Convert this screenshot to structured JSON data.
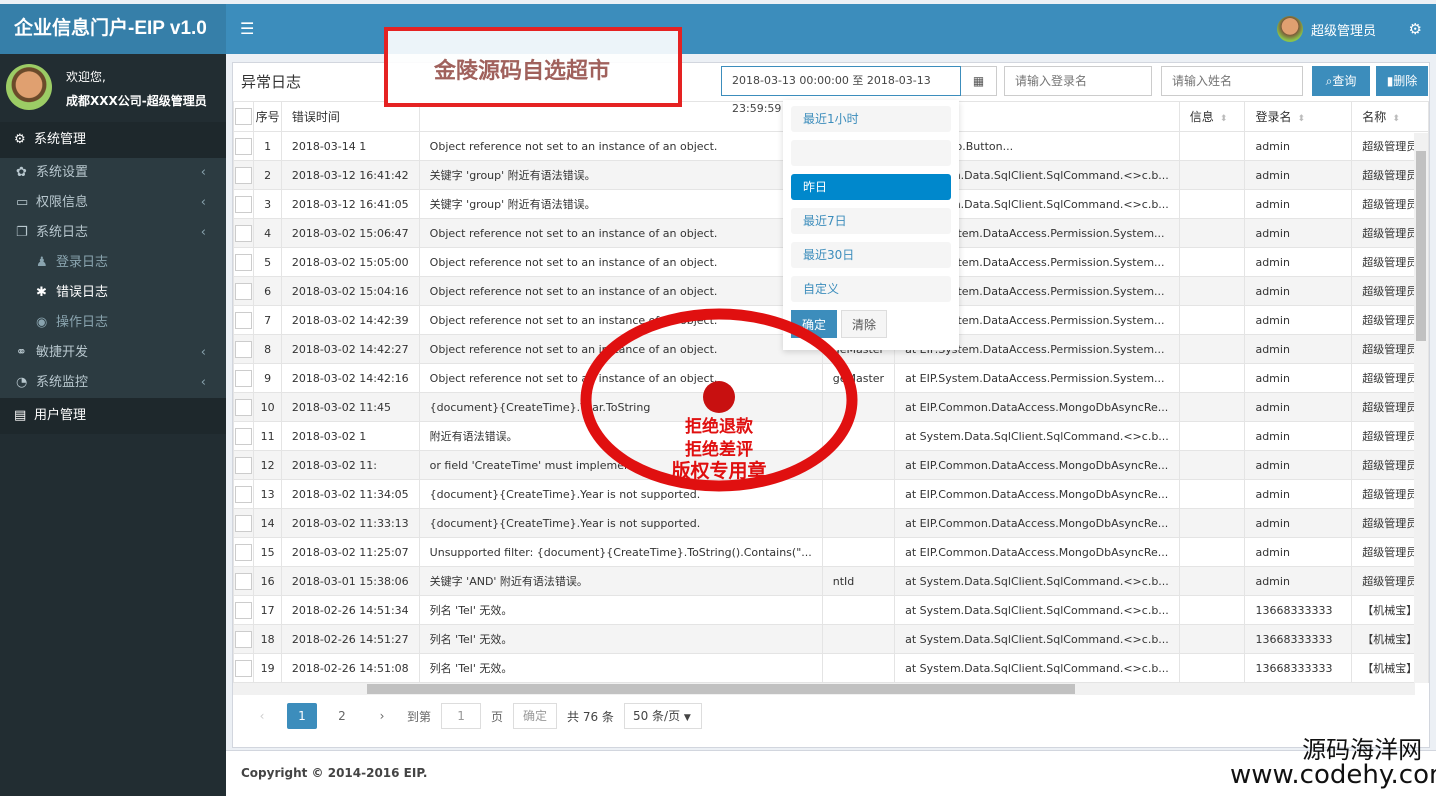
{
  "app": {
    "title": "企业信息门户-EIP v1.0"
  },
  "topbar": {
    "username": "超级管理员"
  },
  "user_panel": {
    "welcome": "欢迎您,",
    "company": "成都XXX公司-超级管理员"
  },
  "sidebar": {
    "sys_mgmt": "系统管理",
    "items": [
      {
        "label": "系统设置",
        "icon": "gear-icon"
      },
      {
        "label": "权限信息",
        "icon": "monitor-icon"
      },
      {
        "label": "系统日志",
        "icon": "files-icon"
      }
    ],
    "log_items": [
      {
        "label": "登录日志",
        "icon": "user-icon"
      },
      {
        "label": "错误日志",
        "icon": "bug-icon",
        "active": true
      },
      {
        "label": "操作日志",
        "icon": "eye-icon"
      }
    ],
    "items2": [
      {
        "label": "敏捷开发",
        "icon": "handshake-icon"
      },
      {
        "label": "系统监控",
        "icon": "dashboard-icon"
      }
    ],
    "user_mgmt": "用户管理"
  },
  "page": {
    "title": "异常日志",
    "date_range": "2018-03-13 00:00:00 至 2018-03-13 23:59:59",
    "login_placeholder": "请输入登录名",
    "name_placeholder": "请输入姓名",
    "search_label": "查询",
    "delete_label": "删除"
  },
  "date_dropdown": {
    "options": [
      "最近1小时",
      "",
      "昨日",
      "最近7日",
      "最近30日",
      "自定义"
    ],
    "active": "昨日",
    "ok": "确定",
    "clear": "清除"
  },
  "table": {
    "headers": [
      "序号",
      "错误时间",
      "",
      "",
      "",
      "信息",
      "登录名",
      "名称"
    ],
    "rows": [
      [
        "1",
        "2018-03-14 1",
        "Object reference not set to an instance of an object.",
        "",
        "at EIP.Web.Button...",
        "",
        "admin",
        "超级管理员"
      ],
      [
        "2",
        "2018-03-12 16:41:42",
        "关键字 'group' 附近有语法错误。",
        "",
        "at System.Data.SqlClient.SqlCommand.<>c.b...",
        "",
        "admin",
        "超级管理员"
      ],
      [
        "3",
        "2018-03-12 16:41:05",
        "关键字 'group' 附近有语法错误。",
        "",
        "at System.Data.SqlClient.SqlCommand.<>c.b...",
        "",
        "admin",
        "超级管理员"
      ],
      [
        "4",
        "2018-03-02 15:06:47",
        "Object reference not set to an instance of an object.",
        "",
        "at EIP.System.DataAccess.Permission.System...",
        "",
        "admin",
        "超级管理员"
      ],
      [
        "5",
        "2018-03-02 15:05:00",
        "Object reference not set to an instance of an object.",
        "",
        "at EIP.System.DataAccess.Permission.System...",
        "",
        "admin",
        "超级管理员"
      ],
      [
        "6",
        "2018-03-02 15:04:16",
        "Object reference not set to an instance of an object.",
        "",
        "at EIP.System.DataAccess.Permission.System...",
        "",
        "admin",
        "超级管理员"
      ],
      [
        "7",
        "2018-03-02 14:42:39",
        "Object reference not set to an instance of an object.",
        "",
        "at EIP.System.DataAccess.Permission.System...",
        "",
        "admin",
        "超级管理员"
      ],
      [
        "8",
        "2018-03-02 14:42:27",
        "Object reference not set to an instance of an object.",
        "geMaster",
        "at EIP.System.DataAccess.Permission.System...",
        "",
        "admin",
        "超级管理员"
      ],
      [
        "9",
        "2018-03-02 14:42:16",
        "Object reference not set to an instance of an object.",
        "geMaster",
        "at EIP.System.DataAccess.Permission.System...",
        "",
        "admin",
        "超级管理员"
      ],
      [
        "10",
        "2018-03-02 11:45",
        "{document}{CreateTime}.Year.ToString",
        "",
        "at EIP.Common.DataAccess.MongoDbAsyncRe...",
        "",
        "admin",
        "超级管理员"
      ],
      [
        "11",
        "2018-03-02 1",
        "附近有语法错误。",
        "",
        "at System.Data.SqlClient.SqlCommand.<>c.b...",
        "",
        "admin",
        "超级管理员"
      ],
      [
        "12",
        "2018-03-02 11:",
        "or field 'CreateTime' must implement",
        "",
        "at EIP.Common.DataAccess.MongoDbAsyncRe...",
        "",
        "admin",
        "超级管理员"
      ],
      [
        "13",
        "2018-03-02 11:34:05",
        "{document}{CreateTime}.Year is not supported.",
        "",
        "at EIP.Common.DataAccess.MongoDbAsyncRe...",
        "",
        "admin",
        "超级管理员"
      ],
      [
        "14",
        "2018-03-02 11:33:13",
        "{document}{CreateTime}.Year is not supported.",
        "",
        "at EIP.Common.DataAccess.MongoDbAsyncRe...",
        "",
        "admin",
        "超级管理员"
      ],
      [
        "15",
        "2018-03-02 11:25:07",
        "Unsupported filter: {document}{CreateTime}.ToString().Contains(\"...",
        "",
        "at EIP.Common.DataAccess.MongoDbAsyncRe...",
        "",
        "admin",
        "超级管理员"
      ],
      [
        "16",
        "2018-03-01 15:38:06",
        "关键字 'AND' 附近有语法错误。",
        "ntId",
        "at System.Data.SqlClient.SqlCommand.<>c.b...",
        "",
        "admin",
        "超级管理员"
      ],
      [
        "17",
        "2018-02-26 14:51:34",
        "列名 'Tel' 无效。",
        "",
        "at System.Data.SqlClient.SqlCommand.<>c.b...",
        "",
        "13668333333",
        "【机械宝】"
      ],
      [
        "18",
        "2018-02-26 14:51:27",
        "列名 'Tel' 无效。",
        "",
        "at System.Data.SqlClient.SqlCommand.<>c.b...",
        "",
        "13668333333",
        "【机械宝】"
      ],
      [
        "19",
        "2018-02-26 14:51:08",
        "列名 'Tel' 无效。",
        "",
        "at System.Data.SqlClient.SqlCommand.<>c.b...",
        "",
        "13668333333",
        "【机械宝】"
      ]
    ]
  },
  "pagination": {
    "pages": [
      "1",
      "2"
    ],
    "current": "1",
    "goto_label": "到第",
    "goto_value": "1",
    "page_unit": "页",
    "confirm": "确定",
    "total": "共 76 条",
    "page_size": "50 条/页"
  },
  "footer": {
    "copyright": "Copyright © 2014-2016 EIP."
  },
  "watermarks": {
    "banner": "金陵源码自选超市",
    "site_name": "源码海洋网",
    "site_url": "www.codehy.com",
    "stamp_lines": [
      "拒绝退款",
      "拒绝差评",
      "版权专用章"
    ]
  },
  "colors": {
    "primary": "#3c8dbc",
    "sidebar": "#222d32",
    "stamp": "#e01010"
  }
}
